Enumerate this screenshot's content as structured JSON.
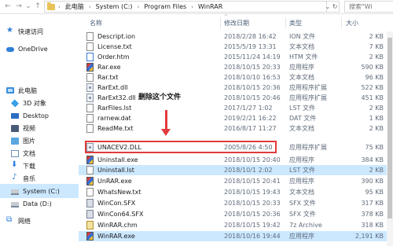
{
  "address": {
    "crumbs": [
      "此电脑",
      "System (C:)",
      "Program Files",
      "WinRAR"
    ],
    "search_placeholder": "搜索\"Wi"
  },
  "columns": {
    "name": "名称",
    "date": "修改日期",
    "type": "类型",
    "size": "大小"
  },
  "nav": {
    "items": [
      {
        "label": "快速访问",
        "icon": "star-icon"
      },
      {
        "label": "OneDrive",
        "icon": "cloud-icon"
      },
      {
        "label": "此电脑",
        "icon": "computer-icon"
      },
      {
        "label": "3D 对象",
        "icon": "3d-objects-icon"
      },
      {
        "label": "Desktop",
        "icon": "desktop-icon"
      },
      {
        "label": "视频",
        "icon": "video-icon"
      },
      {
        "label": "图片",
        "icon": "pictures-icon"
      },
      {
        "label": "文档",
        "icon": "documents-icon"
      },
      {
        "label": "下载",
        "icon": "download-icon"
      },
      {
        "label": "音乐",
        "icon": "music-icon"
      },
      {
        "label": "System (C:)",
        "icon": "drive-icon",
        "selected": true
      },
      {
        "label": "Data (D:)",
        "icon": "drive-icon"
      },
      {
        "label": "网络",
        "icon": "network-icon"
      }
    ]
  },
  "files": [
    {
      "name": "Descript.ion",
      "date": "2018/2/28 16:42",
      "type": "ION 文件",
      "size": "2 KB",
      "icon": "document-icon"
    },
    {
      "name": "License.txt",
      "date": "2015/5/19 13:31",
      "type": "文本文档",
      "size": "7 KB",
      "icon": "text-file-icon"
    },
    {
      "name": "Order.htm",
      "date": "2015/11/24 14:19",
      "type": "HTM 文件",
      "size": "2 KB",
      "icon": "html-file-icon"
    },
    {
      "name": "Rar.exe",
      "date": "2018/10/15 20:33",
      "type": "应用程序",
      "size": "590 KB",
      "icon": "exe-icon"
    },
    {
      "name": "Rar.txt",
      "date": "2018/10/10 16:53",
      "type": "文本文档",
      "size": "96 KB",
      "icon": "text-file-icon"
    },
    {
      "name": "RarExt.dll",
      "date": "2018/10/15 20:36",
      "type": "应用程序扩展",
      "size": "522 KB",
      "icon": "dll-icon"
    },
    {
      "name": "RarExt32.dll",
      "date": "2018/10/15 20:46",
      "type": "应用程序扩展",
      "size": "451 KB",
      "icon": "dll-icon"
    },
    {
      "name": "RarFiles.lst",
      "date": "2017/1/27 1:02",
      "type": "LST 文件",
      "size": "2 KB",
      "icon": "document-icon"
    },
    {
      "name": "rarnew.dat",
      "date": "2019/2/21 16:22",
      "type": "DAT 文件",
      "size": "1 KB",
      "icon": "document-icon"
    },
    {
      "name": "ReadMe.txt",
      "date": "2016/8/17 11:27",
      "type": "文本文档",
      "size": "2 KB",
      "icon": "text-file-icon"
    },
    {
      "name": "UNACEV2.DLL",
      "date": "2005/8/26 4:50",
      "type": "应用程序扩展",
      "size": "75 KB",
      "icon": "dll-icon",
      "highlighted": true
    },
    {
      "name": "Uninstall.exe",
      "date": "2018/10/15 20:40",
      "type": "应用程序",
      "size": "384 KB",
      "icon": "exe-icon"
    },
    {
      "name": "Uninstall.lst",
      "date": "2018/10/1 2:02",
      "type": "LST 文件",
      "size": "2 KB",
      "icon": "document-icon",
      "selected": true
    },
    {
      "name": "UnRAR.exe",
      "date": "2018/10/15 20:41",
      "type": "应用程序",
      "size": "390 KB",
      "icon": "exe-icon"
    },
    {
      "name": "WhatsNew.txt",
      "date": "2018/10/15 19:43",
      "type": "文本文档",
      "size": "95 KB",
      "icon": "text-file-icon"
    },
    {
      "name": "WinCon.SFX",
      "date": "2018/10/15 20:33",
      "type": "SFX 文件",
      "size": "317 KB",
      "icon": "sfx-file-icon"
    },
    {
      "name": "WinCon64.SFX",
      "date": "2018/10/15 20:36",
      "type": "SFX 文件",
      "size": "378 KB",
      "icon": "sfx-file-icon"
    },
    {
      "name": "WinRAR.chm",
      "date": "2018/10/15 19:42",
      "type": "7z Archive",
      "size": "318 KB",
      "icon": "chm-file-icon"
    },
    {
      "name": "WinRAR.exe",
      "date": "2018/10/16 19:44",
      "type": "应用程序",
      "size": "2,191 KB",
      "icon": "winrar-exe-icon",
      "selected": true
    }
  ],
  "annotation": {
    "text": "删除这个文件",
    "color": "#e23b3b"
  }
}
